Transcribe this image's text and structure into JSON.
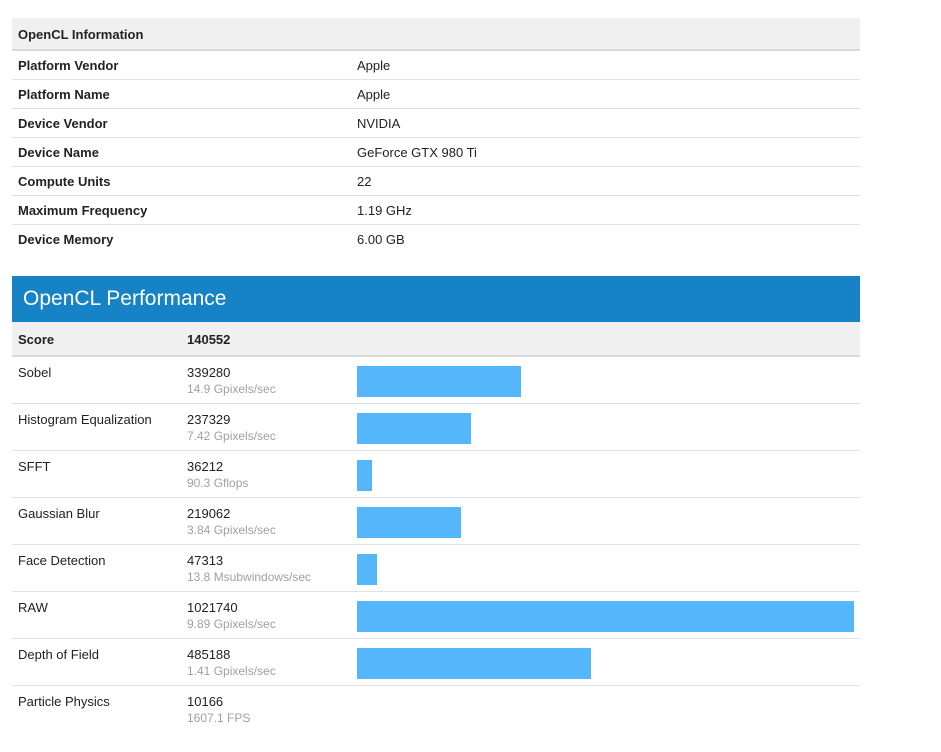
{
  "info": {
    "title": "OpenCL Information",
    "rows": [
      {
        "label": "Platform Vendor",
        "value": "Apple"
      },
      {
        "label": "Platform Name",
        "value": "Apple"
      },
      {
        "label": "Device Vendor",
        "value": "NVIDIA"
      },
      {
        "label": "Device Name",
        "value": "GeForce GTX 980 Ti"
      },
      {
        "label": "Compute Units",
        "value": "22"
      },
      {
        "label": "Maximum Frequency",
        "value": "1.19 GHz"
      },
      {
        "label": "Device Memory",
        "value": "6.00 GB"
      }
    ]
  },
  "performance": {
    "title": "OpenCL Performance",
    "score_label": "Score",
    "score_value": "140552",
    "benchmarks": [
      {
        "name": "Sobel",
        "score": "339280",
        "rate": "14.9 Gpixels/sec",
        "bar_fraction": 0.33
      },
      {
        "name": "Histogram Equalization",
        "score": "237329",
        "rate": "7.42 Gpixels/sec",
        "bar_fraction": 0.23
      },
      {
        "name": "SFFT",
        "score": "36212",
        "rate": "90.3 Gflops",
        "bar_fraction": 0.03
      },
      {
        "name": "Gaussian Blur",
        "score": "219062",
        "rate": "3.84 Gpixels/sec",
        "bar_fraction": 0.21
      },
      {
        "name": "Face Detection",
        "score": "47313",
        "rate": "13.8 Msubwindows/sec",
        "bar_fraction": 0.04
      },
      {
        "name": "RAW",
        "score": "1021740",
        "rate": "9.89 Gpixels/sec",
        "bar_fraction": 1.0
      },
      {
        "name": "Depth of Field",
        "score": "485188",
        "rate": "1.41 Gpixels/sec",
        "bar_fraction": 0.47
      },
      {
        "name": "Particle Physics",
        "score": "10166",
        "rate": "1607.1 FPS",
        "bar_fraction": 0.0
      }
    ]
  },
  "colors": {
    "banner": "#1583c6",
    "bar": "#54b6fb"
  }
}
